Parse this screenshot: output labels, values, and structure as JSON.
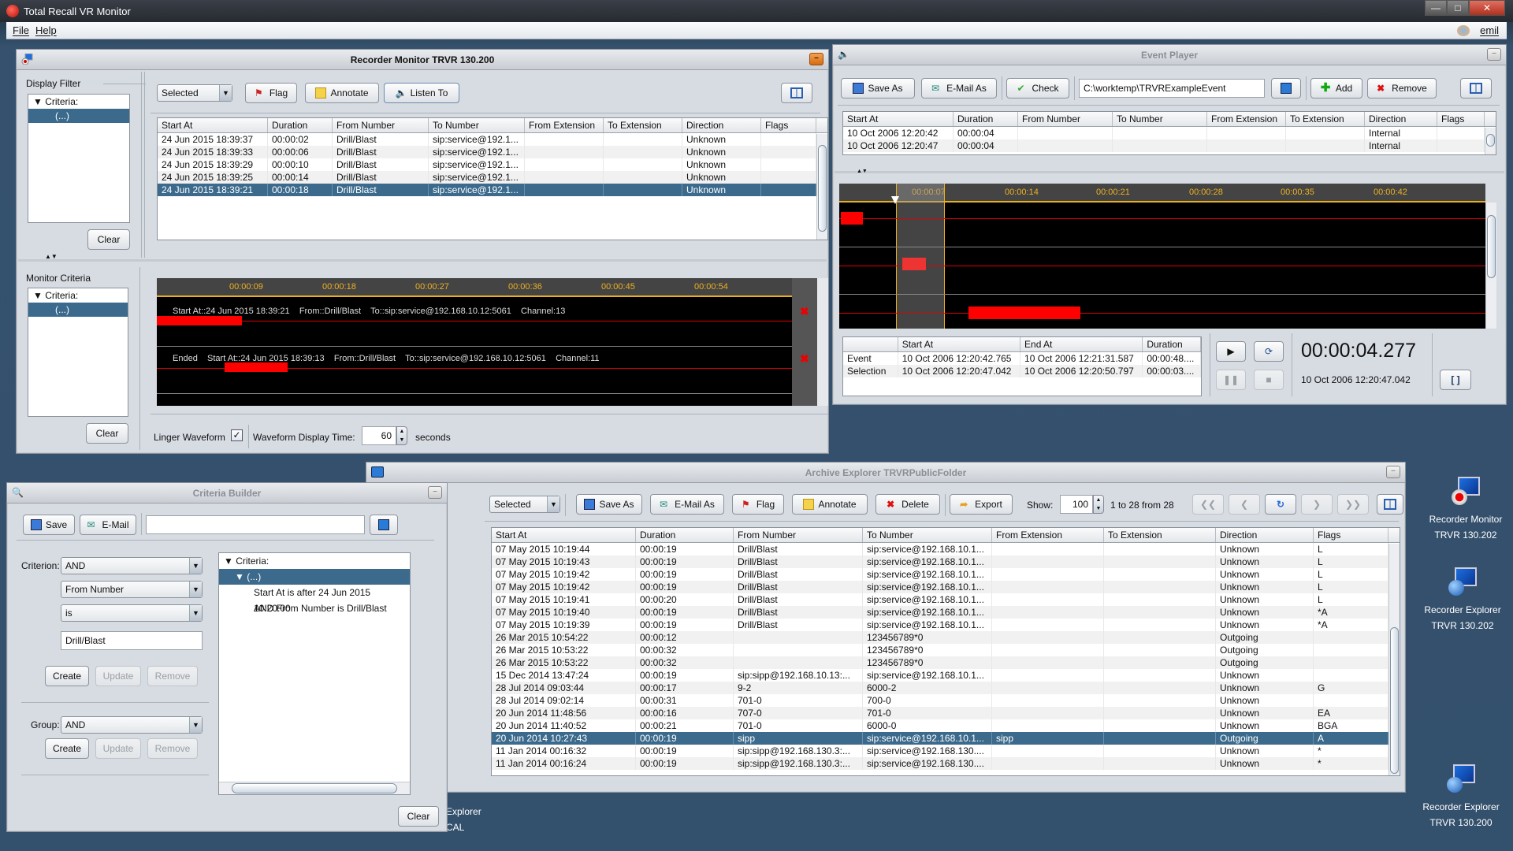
{
  "app": {
    "title": "Total Recall VR Monitor",
    "menu": [
      "File",
      "Help"
    ],
    "user": "emil"
  },
  "recorder_monitor": {
    "title": "Recorder Monitor TRVR 130.200",
    "display_filter": {
      "label": "Display Filter",
      "tree_root": "Criteria:",
      "tree_child": "(...)",
      "clear": "Clear"
    },
    "monitor_criteria": {
      "label": "Monitor Criteria",
      "tree_root": "Criteria:",
      "tree_child": "(...)",
      "clear": "Clear"
    },
    "toolbar": {
      "selector": "Selected",
      "flag": "Flag",
      "annotate": "Annotate",
      "listen": "Listen To"
    },
    "columns": [
      "Start At",
      "Duration",
      "From Number",
      "To Number",
      "From Extension",
      "To Extension",
      "Direction",
      "Flags"
    ],
    "rows": [
      [
        "24 Jun 2015 18:39:37",
        "00:00:02",
        "Drill/Blast",
        "sip:service@192.1...",
        "",
        "",
        "Unknown",
        ""
      ],
      [
        "24 Jun 2015 18:39:33",
        "00:00:06",
        "Drill/Blast",
        "sip:service@192.1...",
        "",
        "",
        "Unknown",
        ""
      ],
      [
        "24 Jun 2015 18:39:29",
        "00:00:10",
        "Drill/Blast",
        "sip:service@192.1...",
        "",
        "",
        "Unknown",
        ""
      ],
      [
        "24 Jun 2015 18:39:25",
        "00:00:14",
        "Drill/Blast",
        "sip:service@192.1...",
        "",
        "",
        "Unknown",
        ""
      ],
      [
        "24 Jun 2015 18:39:21",
        "00:00:18",
        "Drill/Blast",
        "sip:service@192.1...",
        "",
        "",
        "Unknown",
        ""
      ]
    ],
    "selected_row": 4,
    "ruler": [
      "00:00:09",
      "00:00:18",
      "00:00:27",
      "00:00:36",
      "00:00:45",
      "00:00:54"
    ],
    "channels": [
      {
        "text": "Start At::24 Jun 2015 18:39:21    From::Drill/Blast    To::sip:service@192.168.10.12:5061    Channel:13"
      },
      {
        "text": "Ended    Start At::24 Jun 2015 18:39:13    From::Drill/Blast    To::sip:service@192.168.10.12:5061    Channel:11"
      }
    ],
    "footer": {
      "linger": "Linger Waveform",
      "linger_checked": true,
      "display_time_label": "Waveform Display Time:",
      "display_time": "60",
      "unit": "seconds"
    }
  },
  "event_player": {
    "title": "Event Player",
    "toolbar": {
      "save_as": "Save As",
      "email_as": "E-Mail As",
      "check": "Check",
      "path": "C:\\worktemp\\TRVRExampleEvent",
      "add": "Add",
      "remove": "Remove"
    },
    "columns": [
      "Start At",
      "Duration",
      "From Number",
      "To Number",
      "From Extension",
      "To Extension",
      "Direction",
      "Flags"
    ],
    "rows": [
      [
        "10 Oct 2006 12:20:42",
        "00:00:04",
        "",
        "",
        "",
        "",
        "Internal",
        ""
      ],
      [
        "10 Oct 2006 12:20:47",
        "00:00:04",
        "",
        "",
        "",
        "",
        "Internal",
        ""
      ]
    ],
    "ruler": [
      "00:00:07",
      "00:00:14",
      "00:00:21",
      "00:00:28",
      "00:00:35",
      "00:00:42"
    ],
    "info_columns": [
      "",
      "Start At",
      "End At",
      "Duration"
    ],
    "info_rows": [
      [
        "Event",
        "10 Oct 2006 12:20:42.765",
        "10 Oct 2006 12:21:31.587",
        "00:00:48...."
      ],
      [
        "Selection",
        "10 Oct 2006 12:20:47.042",
        "10 Oct 2006 12:20:50.797",
        "00:00:03...."
      ]
    ],
    "clock": "00:00:04.277",
    "clock_date": "10 Oct 2006 12:20:47.042"
  },
  "criteria_builder": {
    "title": "Criteria Builder",
    "save": "Save",
    "email": "E-Mail",
    "name_value": "",
    "criterion_label": "Criterion:",
    "criterion_op": "AND",
    "field": "From Number",
    "comparator": "is",
    "value": "Drill/Blast",
    "create": "Create",
    "update": "Update",
    "remove": "Remove",
    "group_label": "Group:",
    "group_op": "AND",
    "tree_root": "Criteria:",
    "tree_group": "(...)",
    "tree_items": [
      "Start At is after 24 Jun 2015 10:20:00",
      "AND From Number is Drill/Blast"
    ],
    "clear": "Clear"
  },
  "archive_explorer": {
    "title": "Archive Explorer TRVRPublicFolder",
    "toolbar": {
      "selector": "Selected",
      "save_as": "Save As",
      "email_as": "E-Mail As",
      "flag": "Flag",
      "annotate": "Annotate",
      "delete": "Delete",
      "export": "Export",
      "show_label": "Show:",
      "show_value": "100",
      "range": "1 to 28 from 28"
    },
    "columns": [
      "Start At",
      "Duration",
      "From Number",
      "To Number",
      "From Extension",
      "To Extension",
      "Direction",
      "Flags"
    ],
    "rows": [
      [
        "07 May 2015 10:19:44",
        "00:00:19",
        "Drill/Blast",
        "sip:service@192.168.10.1...",
        "",
        "",
        "Unknown",
        "L"
      ],
      [
        "07 May 2015 10:19:43",
        "00:00:19",
        "Drill/Blast",
        "sip:service@192.168.10.1...",
        "",
        "",
        "Unknown",
        "L"
      ],
      [
        "07 May 2015 10:19:42",
        "00:00:19",
        "Drill/Blast",
        "sip:service@192.168.10.1...",
        "",
        "",
        "Unknown",
        "L"
      ],
      [
        "07 May 2015 10:19:42",
        "00:00:19",
        "Drill/Blast",
        "sip:service@192.168.10.1...",
        "",
        "",
        "Unknown",
        "L"
      ],
      [
        "07 May 2015 10:19:41",
        "00:00:20",
        "Drill/Blast",
        "sip:service@192.168.10.1...",
        "",
        "",
        "Unknown",
        "L"
      ],
      [
        "07 May 2015 10:19:40",
        "00:00:19",
        "Drill/Blast",
        "sip:service@192.168.10.1...",
        "",
        "",
        "Unknown",
        "*A"
      ],
      [
        "07 May 2015 10:19:39",
        "00:00:19",
        "Drill/Blast",
        "sip:service@192.168.10.1...",
        "",
        "",
        "Unknown",
        "*A"
      ],
      [
        "26 Mar 2015 10:54:22",
        "00:00:12",
        "",
        "123456789*0",
        "",
        "",
        "Outgoing",
        ""
      ],
      [
        "26 Mar 2015 10:53:22",
        "00:00:32",
        "",
        "123456789*0",
        "",
        "",
        "Outgoing",
        ""
      ],
      [
        "26 Mar 2015 10:53:22",
        "00:00:32",
        "",
        "123456789*0",
        "",
        "",
        "Outgoing",
        ""
      ],
      [
        "15 Dec 2014 13:47:24",
        "00:00:19",
        "sip:sipp@192.168.10.13:...",
        "sip:service@192.168.10.1...",
        "",
        "",
        "Unknown",
        ""
      ],
      [
        "28 Jul 2014 09:03:44",
        "00:00:17",
        "9-2",
        "6000-2",
        "",
        "",
        "Unknown",
        "G"
      ],
      [
        "28 Jul 2014 09:02:14",
        "00:00:31",
        "701-0",
        "700-0",
        "",
        "",
        "Unknown",
        ""
      ],
      [
        "20 Jun 2014 11:48:56",
        "00:00:16",
        "707-0",
        "701-0",
        "",
        "",
        "Unknown",
        "EA"
      ],
      [
        "20 Jun 2014 11:40:52",
        "00:00:21",
        "701-0",
        "6000-0",
        "",
        "",
        "Unknown",
        "BGA"
      ],
      [
        "20 Jun 2014 10:27:43",
        "00:00:19",
        "sipp",
        "sip:service@192.168.10.1...",
        "sipp",
        "",
        "Outgoing",
        "A"
      ],
      [
        "11 Jan 2014 00:16:32",
        "00:00:19",
        "sip:sipp@192.168.130.3:...",
        "sip:service@192.168.130....",
        "",
        "",
        "Unknown",
        "*"
      ],
      [
        "11 Jan 2014 00:16:24",
        "00:00:19",
        "sip:sipp@192.168.130.3:...",
        "sip:service@192.168.130....",
        "",
        "",
        "Unknown",
        "*"
      ]
    ],
    "selected_row": 15
  },
  "desktop_icons": [
    {
      "line1": "Recorder Monitor",
      "line2": "TRVR 130.202",
      "kind": "monitor"
    },
    {
      "line1": "Recorder Explorer",
      "line2": "TRVR 130.202",
      "kind": "explorer"
    },
    {
      "line1": "Recorder Explorer",
      "line2": "TRVR 130.200",
      "kind": "explorer"
    },
    {
      "line1": "ve Explorer",
      "line2": "LOCAL",
      "kind": "partial"
    }
  ],
  "colors": {
    "selection": "#3b6a8c",
    "waveform": "#ff0000",
    "ruler_text": "#f0b020",
    "desktop": "#33506c"
  }
}
